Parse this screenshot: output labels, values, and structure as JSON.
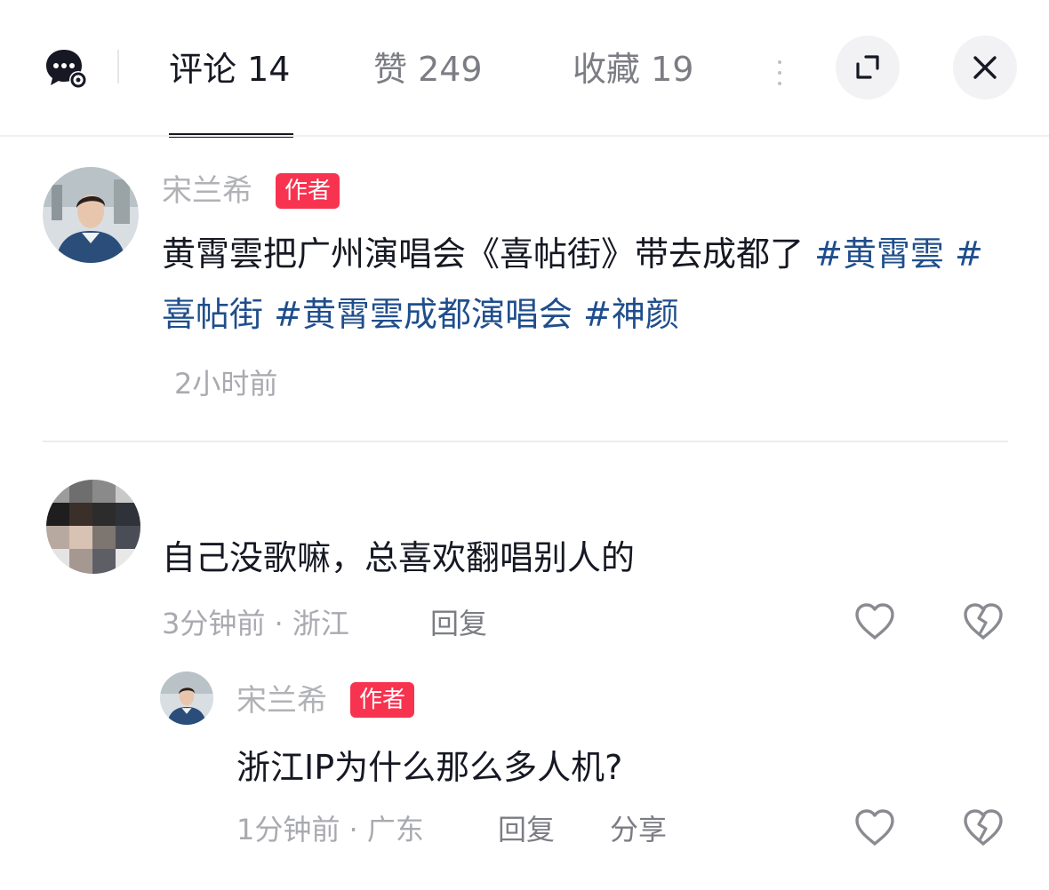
{
  "header": {
    "tabs": [
      {
        "label": "评论 14",
        "active": true
      },
      {
        "label": "赞 249",
        "active": false
      },
      {
        "label": "收藏 19",
        "active": false
      }
    ],
    "icons": {
      "messages": "chat-bubble-settings-icon",
      "more": "more-icon",
      "expand": "expand-icon",
      "close": "close-icon"
    }
  },
  "post": {
    "author_name": "宋兰希",
    "badge": "作者",
    "text_plain": "黄霄雲把广州演唱会《喜帖街》带去成都了 ",
    "hashtags": [
      "#黄霄雲",
      "#喜帖街",
      "#黄霄雲成都演唱会",
      "#神颜"
    ],
    "time": "2小时前"
  },
  "comments": [
    {
      "author_name": "",
      "avatar": "pixelated-avatar",
      "text": "自己没歌嘛，总喜欢翻唱别人的",
      "meta": "3分钟前 · 浙江",
      "reply_label": "回复",
      "replies": [
        {
          "author_name": "宋兰希",
          "badge": "作者",
          "text": "浙江IP为什么那么多人机?",
          "meta": "1分钟前 · 广东",
          "reply_label": "回复",
          "share_label": "分享"
        }
      ]
    }
  ],
  "colors": {
    "badge": "#f8334f",
    "hashtag": "#1f4e8c",
    "muted": "#a9aab0",
    "text": "#161823"
  }
}
